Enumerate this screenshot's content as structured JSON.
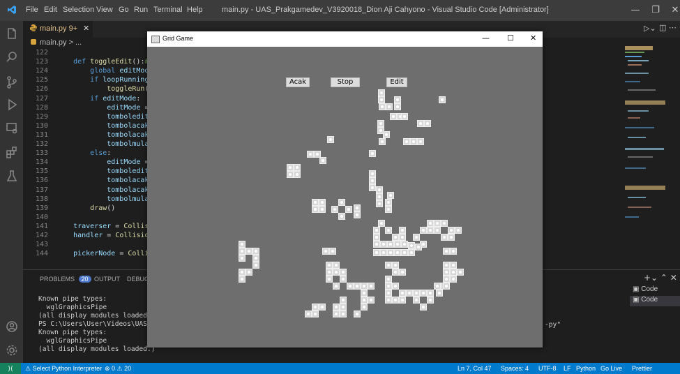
{
  "vscode": {
    "menu": [
      "File",
      "Edit",
      "Selection",
      "View",
      "Go",
      "Run",
      "Terminal",
      "Help"
    ],
    "window_title": "main.py - UAS_Prakgamedev_V3920018_Dion Aji Cahyono - Visual Studio Code [Administrator]",
    "tab_label": "main.py 9+",
    "breadcrumb": "main.py > ...",
    "code_lines": [
      {
        "n": "122",
        "html": ""
      },
      {
        "n": "123",
        "html": "    <span class='kw'>def</span> <span class='fn'>toggleEdit</span>():<span class='cm'>#func</span>"
      },
      {
        "n": "124",
        "html": "        <span class='kw'>global</span> <span class='vr'>editMode</span>"
      },
      {
        "n": "125",
        "html": "        <span class='kw'>if</span> <span class='vr'>loopRunning</span>:"
      },
      {
        "n": "126",
        "html": "            <span class='fn'>toggleRun</span>()"
      },
      {
        "n": "127",
        "html": "        <span class='kw'>if</span> <span class='vr'>editMode</span>:"
      },
      {
        "n": "128",
        "html": "            <span class='vr'>editMode</span> = <span class='kw'>Fal</span>"
      },
      {
        "n": "129",
        "html": "            <span class='vr'>tomboledit</span>[<span class='st'>\"te</span>"
      },
      {
        "n": "130",
        "html": "            <span class='vr'>tombolacak</span>[<span class='st'>\"te</span>"
      },
      {
        "n": "131",
        "html": "            <span class='vr'>tombolacak</span>[<span class='st'>\"co</span>"
      },
      {
        "n": "132",
        "html": "            <span class='vr'>tombolmulai</span>.sh"
      },
      {
        "n": "133",
        "html": "        <span class='kw'>else</span>:"
      },
      {
        "n": "134",
        "html": "            <span class='vr'>editMode</span> = <span class='kw'>Tru</span>"
      },
      {
        "n": "135",
        "html": "            <span class='vr'>tomboledit</span>[<span class='st'>\"te</span>"
      },
      {
        "n": "136",
        "html": "            <span class='vr'>tombolacak</span>[<span class='st'>\"te</span>"
      },
      {
        "n": "137",
        "html": "            <span class='vr'>tombolacak</span>[<span class='st'>\"co</span>"
      },
      {
        "n": "138",
        "html": "            <span class='vr'>tombolmulai</span>.hi"
      },
      {
        "n": "139",
        "html": "        <span class='fn'>draw</span>()"
      },
      {
        "n": "140",
        "html": ""
      },
      {
        "n": "141",
        "html": "    <span class='vr'>traverser</span> = <span class='fn'>Collision</span>"
      },
      {
        "n": "142",
        "html": "    <span class='vr'>handler</span> = <span class='fn'>CollisionHan</span>"
      },
      {
        "n": "143",
        "html": ""
      },
      {
        "n": "144",
        "html": "    <span class='vr'>pickerNode</span> = <span class='fn'>Collision</span>"
      }
    ],
    "panel_tabs": {
      "problems": "PROBLEMS",
      "problems_count": "20",
      "output": "OUTPUT",
      "debug": "DEBUG C"
    },
    "terminal_lines": [
      "Known pipe types:",
      "  wglGraphicsPipe",
      "(all display modules loaded.)",
      "PS C:\\Users\\User\\Videos\\UAS_Pra",
      "Known pipe types:",
      "  wglGraphicsPipe",
      "(all display modules loaded.)"
    ],
    "terminal_tail": "-py\"",
    "terminals": [
      "Code",
      "Code"
    ],
    "status_left": [
      "Select Python Interpreter",
      "⊗ 0 ⚠ 20"
    ],
    "status_right": [
      "Ln 7, Col 47",
      "Spaces: 4",
      "UTF-8",
      "LF",
      "Python",
      "Go Live",
      "Prettier"
    ]
  },
  "game": {
    "title": "Grid Game",
    "buttons": {
      "acak": "Acak",
      "stop": "Stop",
      "edit": "Edit"
    },
    "colors": {
      "background": "#6e6e6e",
      "cell": "#d8d8d8"
    },
    "live_cells": [
      [
        325,
        61
      ],
      [
        325,
        71
      ],
      [
        412,
        71
      ],
      [
        348,
        71
      ],
      [
        348,
        81
      ],
      [
        326,
        81
      ],
      [
        336,
        81
      ],
      [
        342,
        95
      ],
      [
        352,
        95
      ],
      [
        358,
        95
      ],
      [
        332,
        121
      ],
      [
        326,
        131
      ],
      [
        361,
        131
      ],
      [
        371,
        131
      ],
      [
        381,
        131
      ],
      [
        324,
        105
      ],
      [
        324,
        115
      ],
      [
        381,
        105
      ],
      [
        391,
        105
      ],
      [
        194,
        168
      ],
      [
        204,
        168
      ],
      [
        194,
        178
      ],
      [
        204,
        178
      ],
      [
        223,
        149
      ],
      [
        233,
        149
      ],
      [
        241,
        158
      ],
      [
        252,
        128
      ],
      [
        312,
        148
      ],
      [
        230,
        218
      ],
      [
        240,
        218
      ],
      [
        230,
        228
      ],
      [
        240,
        228
      ],
      [
        258,
        228
      ],
      [
        268,
        218
      ],
      [
        278,
        228
      ],
      [
        268,
        238
      ],
      [
        290,
        226
      ],
      [
        290,
        236
      ],
      [
        312,
        177
      ],
      [
        312,
        187
      ],
      [
        312,
        197
      ],
      [
        322,
        200
      ],
      [
        322,
        210
      ],
      [
        322,
        220
      ],
      [
        335,
        218
      ],
      [
        335,
        228
      ],
      [
        338,
        208
      ],
      [
        325,
        248
      ],
      [
        335,
        258
      ],
      [
        345,
        268
      ],
      [
        355,
        268
      ],
      [
        355,
        258
      ],
      [
        395,
        248
      ],
      [
        405,
        248
      ],
      [
        415,
        248
      ],
      [
        385,
        258
      ],
      [
        395,
        258
      ],
      [
        425,
        258
      ],
      [
        435,
        258
      ],
      [
        375,
        268
      ],
      [
        385,
        278
      ],
      [
        405,
        258
      ],
      [
        415,
        268
      ],
      [
        425,
        268
      ],
      [
        318,
        278
      ],
      [
        328,
        278
      ],
      [
        338,
        278
      ],
      [
        348,
        278
      ],
      [
        358,
        278
      ],
      [
        318,
        290
      ],
      [
        328,
        290
      ],
      [
        338,
        290
      ],
      [
        348,
        290
      ],
      [
        358,
        290
      ],
      [
        368,
        290
      ],
      [
        368,
        280
      ],
      [
        378,
        282
      ],
      [
        318,
        268
      ],
      [
        318,
        258
      ],
      [
        245,
        288
      ],
      [
        255,
        288
      ],
      [
        418,
        288
      ],
      [
        428,
        288
      ],
      [
        125,
        278
      ],
      [
        125,
        288
      ],
      [
        125,
        298
      ],
      [
        135,
        288
      ],
      [
        145,
        288
      ],
      [
        145,
        298
      ],
      [
        145,
        308
      ],
      [
        125,
        318
      ],
      [
        125,
        328
      ],
      [
        135,
        318
      ],
      [
        250,
        308
      ],
      [
        260,
        308
      ],
      [
        250,
        318
      ],
      [
        260,
        318
      ],
      [
        270,
        318
      ],
      [
        250,
        328
      ],
      [
        270,
        328
      ],
      [
        280,
        338
      ],
      [
        260,
        338
      ],
      [
        290,
        338
      ],
      [
        300,
        338
      ],
      [
        310,
        338
      ],
      [
        300,
        348
      ],
      [
        300,
        358
      ],
      [
        300,
        368
      ],
      [
        310,
        358
      ],
      [
        270,
        358
      ],
      [
        260,
        368
      ],
      [
        270,
        368
      ],
      [
        230,
        368
      ],
      [
        240,
        368
      ],
      [
        220,
        378
      ],
      [
        230,
        378
      ],
      [
        260,
        378
      ],
      [
        270,
        378
      ],
      [
        290,
        378
      ],
      [
        335,
        308
      ],
      [
        345,
        308
      ],
      [
        345,
        318
      ],
      [
        355,
        318
      ],
      [
        335,
        328
      ],
      [
        335,
        338
      ],
      [
        345,
        338
      ],
      [
        355,
        348
      ],
      [
        365,
        348
      ],
      [
        375,
        348
      ],
      [
        375,
        358
      ],
      [
        335,
        348
      ],
      [
        335,
        358
      ],
      [
        345,
        358
      ],
      [
        355,
        358
      ],
      [
        385,
        348
      ],
      [
        395,
        348
      ],
      [
        405,
        338
      ],
      [
        415,
        338
      ],
      [
        395,
        358
      ],
      [
        385,
        368
      ],
      [
        418,
        308
      ],
      [
        418,
        318
      ],
      [
        428,
        308
      ],
      [
        428,
        318
      ],
      [
        438,
        318
      ],
      [
        418,
        328
      ],
      [
        428,
        328
      ],
      [
        418,
        338
      ],
      [
        408,
        348
      ]
    ]
  }
}
